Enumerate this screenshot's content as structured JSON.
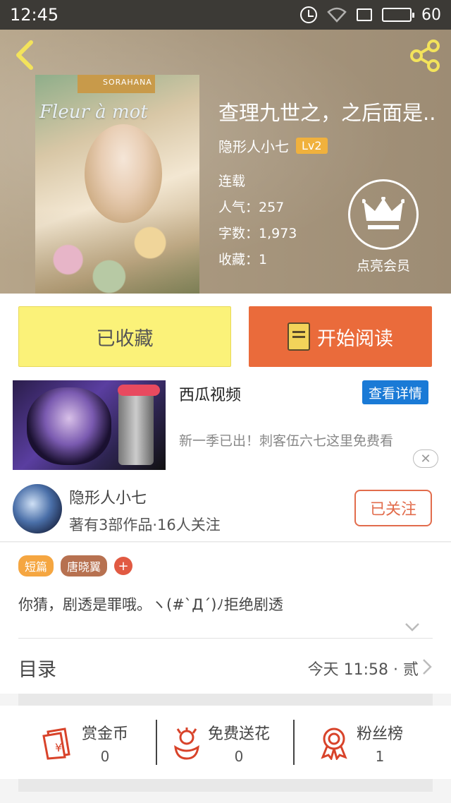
{
  "status_bar": {
    "time": "12:45",
    "battery": "60",
    "battery_level": 0.6
  },
  "book": {
    "title": "查理九世之，之后面是..",
    "author": "隐形人小七",
    "level": "Lv2",
    "status": "连载",
    "popularity": "人气：257",
    "word_count": "字数：1,973",
    "favorites": "收藏：1",
    "cover_text": "Fleur à mot",
    "cover_brand": "SORAHANA"
  },
  "member": {
    "label": "点亮会员"
  },
  "actions": {
    "favorited_label": "已收藏",
    "read_label": "开始阅读"
  },
  "ad": {
    "title": "西瓜视频",
    "detail_label": "查看详情",
    "description": "新一季已出！刺客伍六七这里免费看",
    "close_label": "✕"
  },
  "author_row": {
    "name": "隐形人小七",
    "stats": "著有3部作品·16人关注",
    "follow_label": "已关注"
  },
  "tags": [
    "短篇",
    "唐晓翼"
  ],
  "tag_add_label": "+",
  "intro": "你猜，剧透是罪哦。ヽ(#`Д´)ﾉ拒绝剧透",
  "catalog": {
    "label": "目录",
    "latest": "今天 11:58 · 贰"
  },
  "stats": [
    {
      "title": "赏金币",
      "value": "0",
      "icon": "red-envelope-icon"
    },
    {
      "title": "免费送花",
      "value": "0",
      "icon": "flower-icon"
    },
    {
      "title": "粉丝榜",
      "value": "1",
      "icon": "medal-icon"
    }
  ],
  "colors": {
    "accent_orange": "#ea6b3b",
    "fav_yellow": "#fbf279",
    "ad_blue": "#1a7ad6",
    "icon_red": "#d8432a"
  }
}
